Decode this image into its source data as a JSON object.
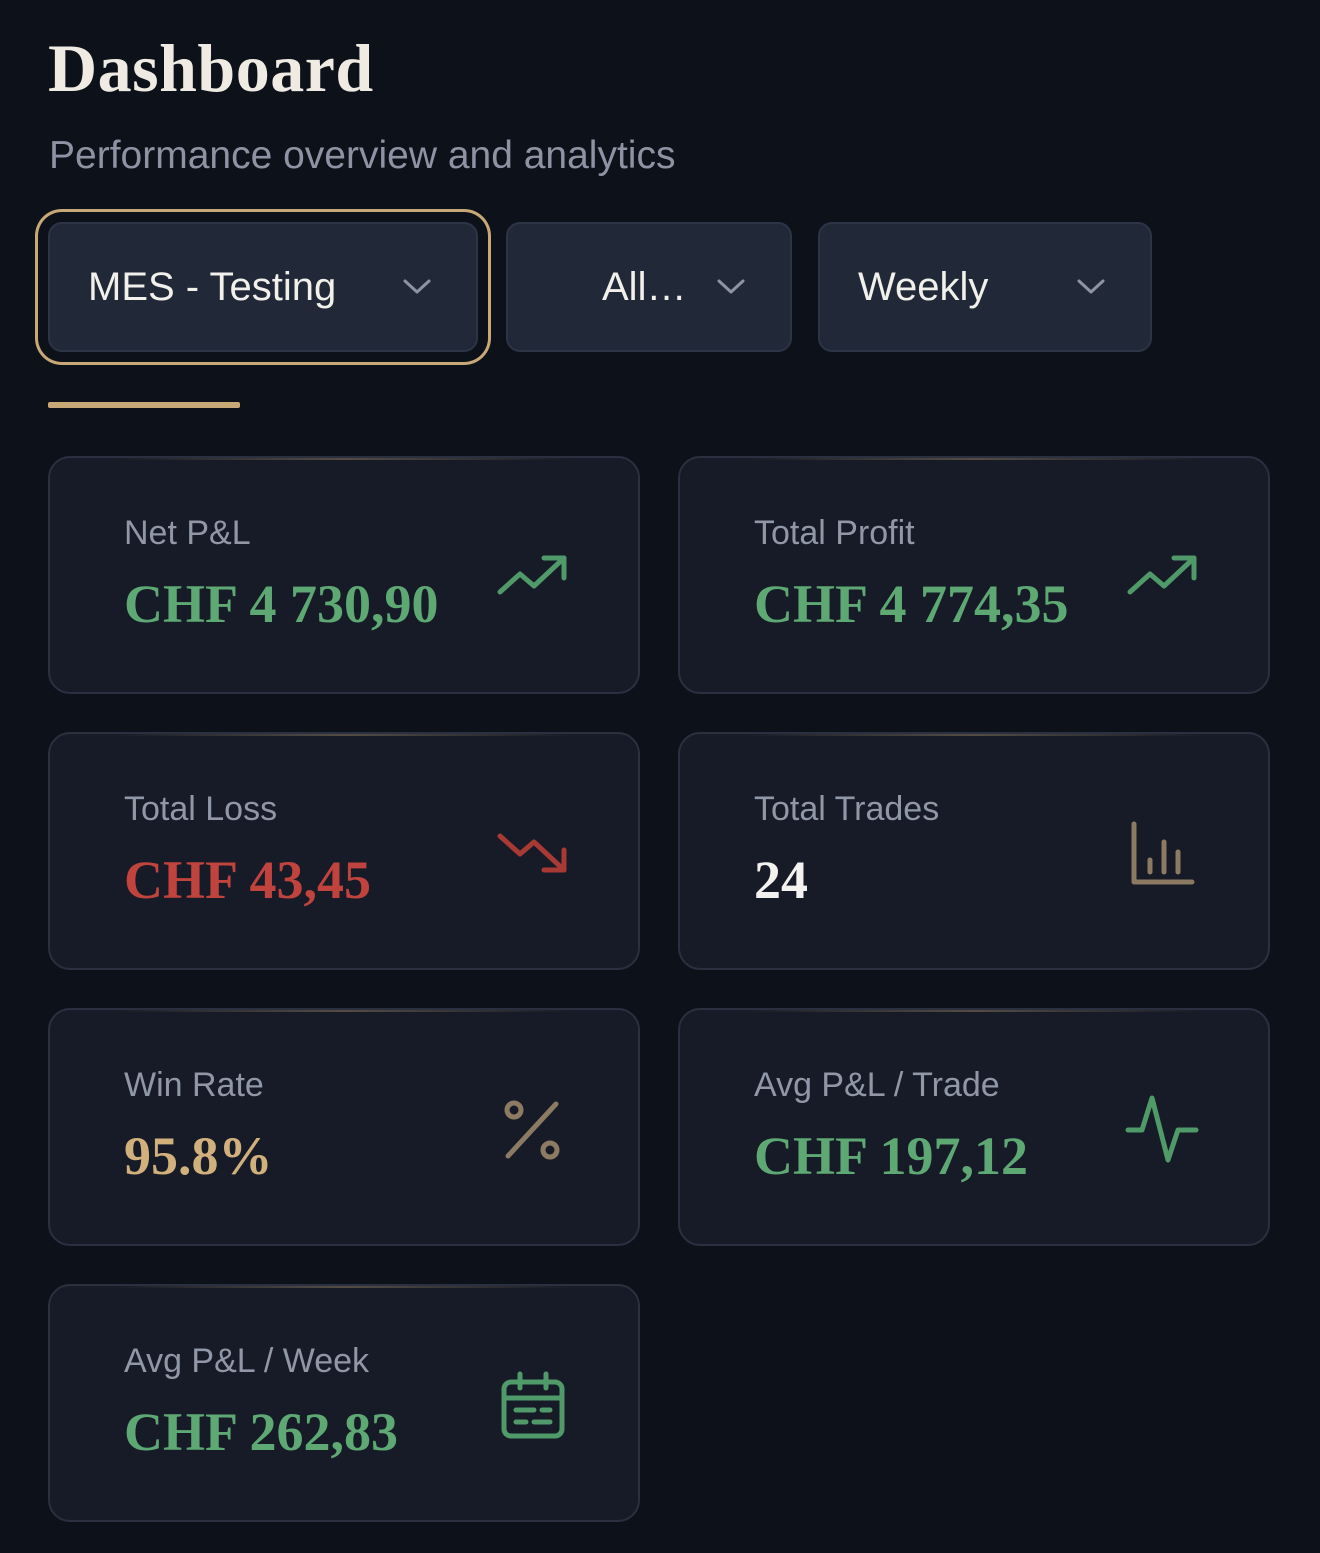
{
  "header": {
    "title": "Dashboard",
    "subtitle": "Performance overview and analytics"
  },
  "filters": {
    "account": {
      "value": "MES - Testing",
      "focused": true
    },
    "instrument": {
      "value": "All…"
    },
    "period": {
      "value": "Weekly"
    }
  },
  "colors": {
    "accent_gold": "#c9a878",
    "positive_green": "#5ea874",
    "negative_red": "#c0433d",
    "neutral_white": "#f4f2ee",
    "rate_gold": "#d2b07c"
  },
  "stats": [
    {
      "id": "net-pnl",
      "label": "Net P&L",
      "value": "CHF 4 730,90",
      "tone": "positive",
      "icon": "trending-up-icon"
    },
    {
      "id": "total-profit",
      "label": "Total Profit",
      "value": "CHF 4 774,35",
      "tone": "positive",
      "icon": "trending-up-icon"
    },
    {
      "id": "total-loss",
      "label": "Total Loss",
      "value": "CHF 43,45",
      "tone": "negative",
      "icon": "trending-down-icon"
    },
    {
      "id": "total-trades",
      "label": "Total Trades",
      "value": "24",
      "tone": "neutral",
      "icon": "bar-chart-icon"
    },
    {
      "id": "win-rate",
      "label": "Win Rate",
      "value": "95.8%",
      "tone": "gold",
      "icon": "percent-icon"
    },
    {
      "id": "avg-pnl-trade",
      "label": "Avg P&L / Trade",
      "value": "CHF 197,12",
      "tone": "positive",
      "icon": "activity-icon"
    },
    {
      "id": "avg-pnl-week",
      "label": "Avg P&L / Week",
      "value": "CHF 262,83",
      "tone": "positive",
      "icon": "calendar-icon"
    }
  ]
}
